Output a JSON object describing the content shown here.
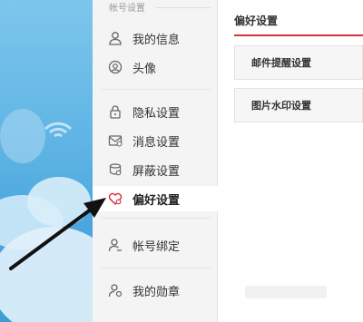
{
  "sidebar": {
    "section_label": "帐号设置",
    "items": [
      {
        "label": "我的信息",
        "icon": "user-icon"
      },
      {
        "label": "头像",
        "icon": "avatar-icon"
      },
      {
        "label": "隐私设置",
        "icon": "lock-icon"
      },
      {
        "label": "消息设置",
        "icon": "message-icon"
      },
      {
        "label": "屏蔽设置",
        "icon": "shield-icon"
      },
      {
        "label": "偏好设置",
        "icon": "heart-gear-icon",
        "active": true
      },
      {
        "label": "帐号绑定",
        "icon": "user-link-icon"
      },
      {
        "label": "我的勋章",
        "icon": "medal-user-icon"
      }
    ]
  },
  "content": {
    "title": "偏好设置",
    "rows": [
      {
        "label": "邮件提醒设置"
      },
      {
        "label": "图片水印设置"
      }
    ]
  },
  "colors": {
    "accent": "#d9333f",
    "bg_blue": "#5fb4e4"
  }
}
